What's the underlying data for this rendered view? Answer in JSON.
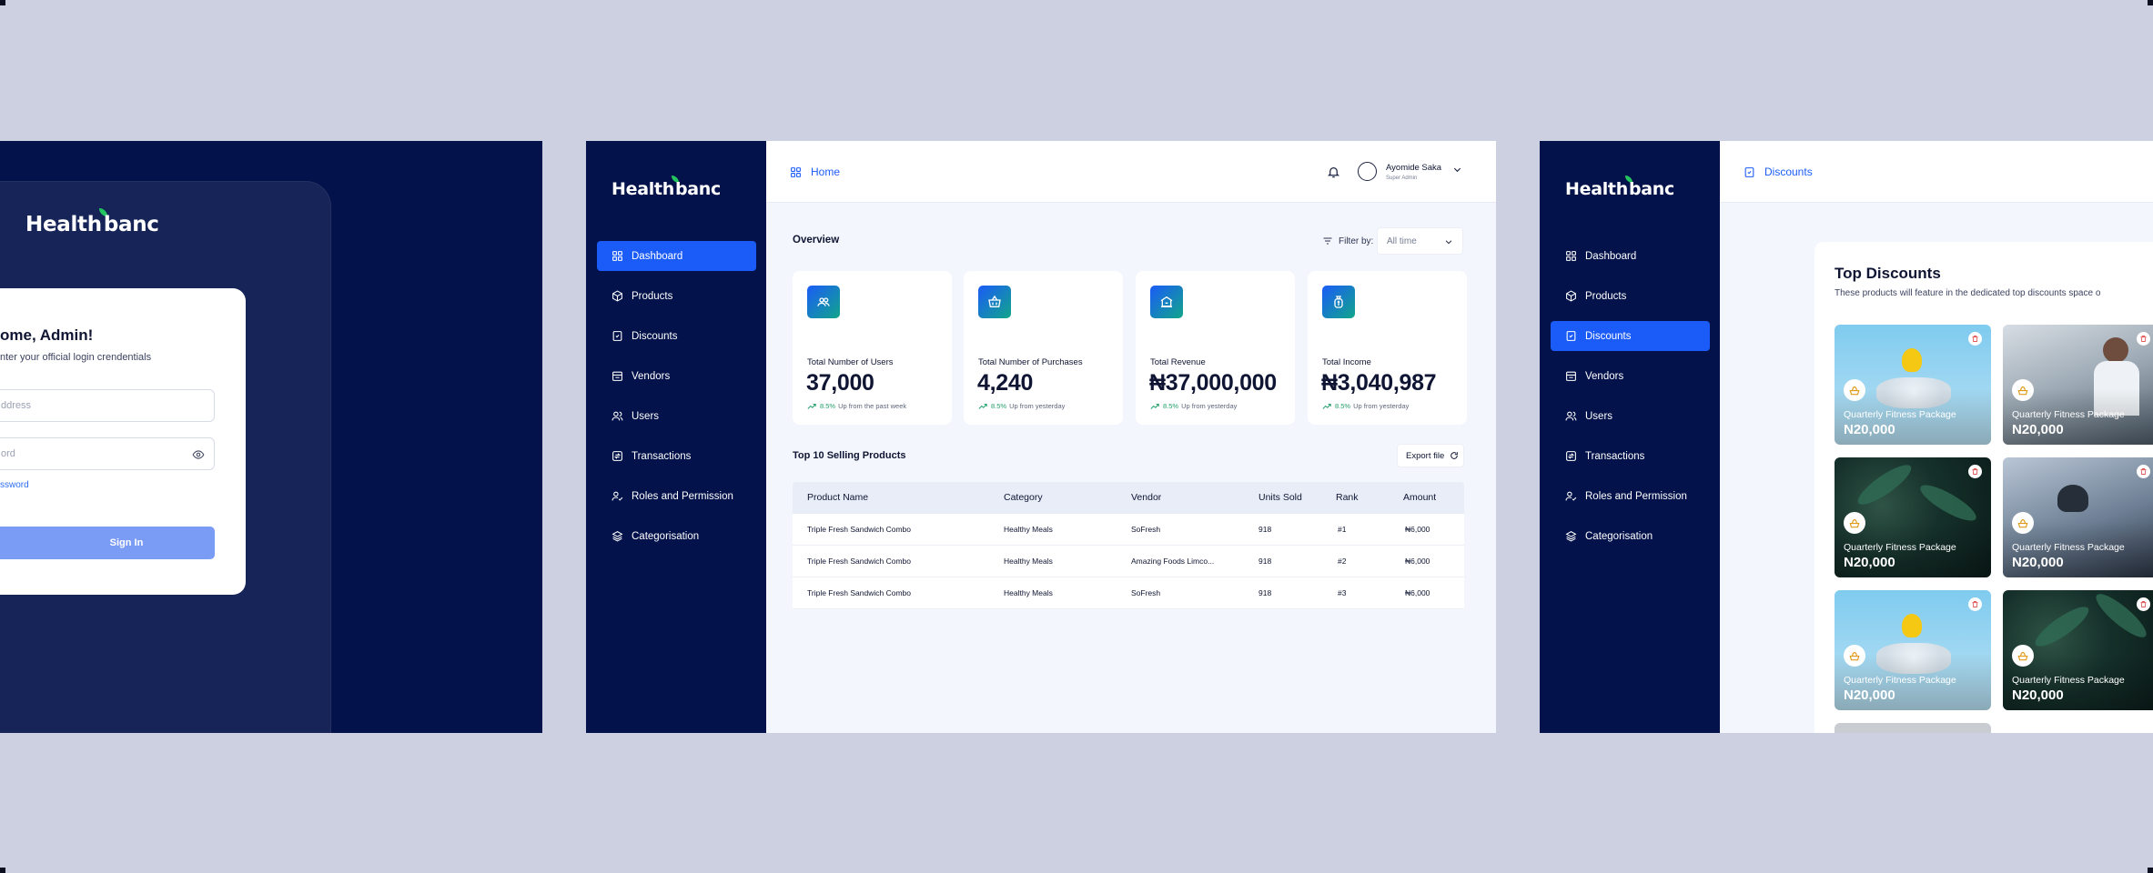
{
  "login": {
    "logo": "Healthbanc",
    "title": "ome, Admin!",
    "subtitle": "nter your official login crendentials",
    "email_placeholder": "ddress",
    "password_placeholder": "ord",
    "forgot_link": "ssword",
    "signin_label": "Sign In"
  },
  "dashboard": {
    "logo": "Healthbanc",
    "sidebar": [
      {
        "label": "Dashboard",
        "icon": "dashboard-icon",
        "active": true
      },
      {
        "label": "Products",
        "icon": "box-icon",
        "active": false
      },
      {
        "label": "Discounts",
        "icon": "discount-icon",
        "active": false
      },
      {
        "label": "Vendors",
        "icon": "store-icon",
        "active": false
      },
      {
        "label": "Users",
        "icon": "users-icon",
        "active": false
      },
      {
        "label": "Transactions",
        "icon": "transactions-icon",
        "active": false
      },
      {
        "label": "Roles and Permission",
        "icon": "user-check-icon",
        "active": false
      },
      {
        "label": "Categorisation",
        "icon": "layers-icon",
        "active": false
      }
    ],
    "breadcrumb": "Home",
    "user": {
      "name": "Ayomide Saka",
      "role": "Super Admin"
    },
    "overview_title": "Overview",
    "filter_label": "Filter by:",
    "filter_value": "All time",
    "stats": [
      {
        "label": "Total Number of Users",
        "value": "37,000",
        "delta": "8.5%",
        "delta_text": "Up from the past week",
        "icon": "users-icon"
      },
      {
        "label": "Total Number of Purchases",
        "value": "4,240",
        "delta": "8.5%",
        "delta_text": "Up from yesterday",
        "icon": "basket-icon"
      },
      {
        "label": "Total Revenue",
        "value": "₦37,000,000",
        "delta": "8.5%",
        "delta_text": "Up from yesterday",
        "icon": "bank-icon"
      },
      {
        "label": "Total Income",
        "value": "₦3,040,987",
        "delta": "8.5%",
        "delta_text": "Up from yesterday",
        "icon": "money-bag-icon"
      }
    ],
    "top_products_title": "Top 10 Selling Products",
    "export_label": "Export file",
    "table": {
      "headers": [
        "Product Name",
        "Category",
        "Vendor",
        "Units Sold",
        "Rank",
        "Amount"
      ],
      "rows": [
        [
          "Triple Fresh Sandwich Combo",
          "Healthy Meals",
          "SoFresh",
          "918",
          "#1",
          "₦6,000"
        ],
        [
          "Triple Fresh Sandwich Combo",
          "Healthy Meals",
          "Amazing Foods Limco...",
          "918",
          "#2",
          "₦6,000"
        ],
        [
          "Triple Fresh Sandwich Combo",
          "Healthy Meals",
          "SoFresh",
          "918",
          "#3",
          "₦6,000"
        ]
      ]
    }
  },
  "discounts": {
    "logo": "Healthbanc",
    "sidebar": [
      {
        "label": "Dashboard",
        "active": false
      },
      {
        "label": "Products",
        "active": false
      },
      {
        "label": "Discounts",
        "active": true
      },
      {
        "label": "Vendors",
        "active": false
      },
      {
        "label": "Users",
        "active": false
      },
      {
        "label": "Transactions",
        "active": false
      },
      {
        "label": "Roles and Permission",
        "active": false
      },
      {
        "label": "Categorisation",
        "active": false
      }
    ],
    "breadcrumb": "Discounts",
    "title": "Top Discounts",
    "subtitle": "These products will feature in the dedicated top discounts space o",
    "tiles": [
      {
        "name": "Quarterly Fitness Package",
        "price": "N20,000",
        "image": "sky"
      },
      {
        "name": "Quarterly Fitness Package",
        "price": "N20,000",
        "image": "office"
      },
      {
        "name": "Quarterly Fitness Package",
        "price": "N20,000",
        "image": "leaves"
      },
      {
        "name": "Quarterly Fitness Package",
        "price": "N20,000",
        "image": "lamp"
      },
      {
        "name": "Quarterly Fitness Package",
        "price": "N20,000",
        "image": "sky"
      },
      {
        "name": "Quarterly Fitness Package",
        "price": "N20,000",
        "image": "leaves"
      }
    ]
  },
  "colors": {
    "navy": "#03124a",
    "primary": "#1b5cf8",
    "signin_button": "#7b9cf5",
    "backdrop": "#cdd0e0",
    "success": "#22a06b",
    "brand_leaf": "#22c55e"
  }
}
